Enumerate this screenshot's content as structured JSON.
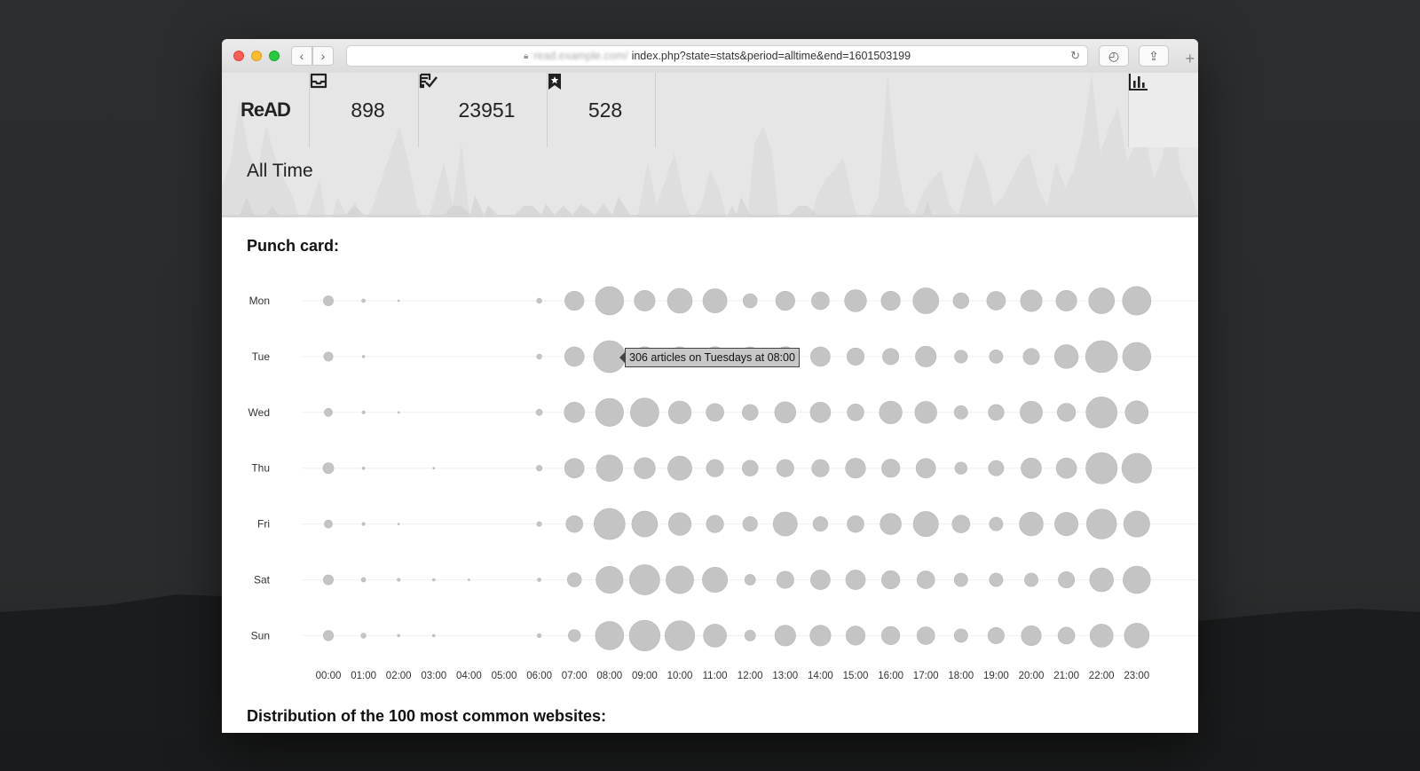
{
  "browser": {
    "url_blurred_host": "read.example.com/",
    "url_path": "index.php?state=stats&period=alltime&end=1601503199"
  },
  "nav": {
    "logo": "ReAD",
    "unread_count": "898",
    "read_count": "23951",
    "bookmarked_count": "528",
    "icons": [
      "inbox-icon",
      "read-check-icon",
      "bookmark-star-icon",
      "bar-chart-icon"
    ]
  },
  "period_title": "All Time",
  "punch_card": {
    "title": "Punch card:",
    "tooltip": "306 articles on Tuesdays at 08:00"
  },
  "next_section_title": "Distribution of the 100 most common websites:",
  "chart_data": {
    "type": "scatter",
    "title": "Punch card:",
    "days": [
      "Mon",
      "Tue",
      "Wed",
      "Thu",
      "Fri",
      "Sat",
      "Sun"
    ],
    "hours": [
      "00:00",
      "01:00",
      "02:00",
      "03:00",
      "04:00",
      "05:00",
      "06:00",
      "07:00",
      "08:00",
      "09:00",
      "10:00",
      "11:00",
      "12:00",
      "13:00",
      "14:00",
      "15:00",
      "16:00",
      "17:00",
      "18:00",
      "19:00",
      "20:00",
      "21:00",
      "22:00",
      "23:00"
    ],
    "values": [
      [
        30,
        4,
        1,
        0,
        0,
        0,
        8,
        110,
        240,
        130,
        185,
        175,
        60,
        110,
        95,
        145,
        110,
        200,
        75,
        105,
        140,
        130,
        200,
        245
      ],
      [
        25,
        2,
        0,
        0,
        0,
        0,
        8,
        115,
        306,
        120,
        115,
        120,
        115,
        120,
        115,
        90,
        80,
        130,
        50,
        55,
        80,
        170,
        305,
        240
      ],
      [
        20,
        3,
        1,
        0,
        0,
        0,
        12,
        125,
        235,
        245,
        155,
        95,
        75,
        135,
        125,
        85,
        155,
        145,
        55,
        75,
        150,
        100,
        290,
        160
      ],
      [
        35,
        2,
        0,
        1,
        0,
        0,
        10,
        115,
        210,
        135,
        175,
        90,
        75,
        90,
        90,
        120,
        100,
        115,
        45,
        70,
        125,
        125,
        295,
        265
      ],
      [
        20,
        3,
        1,
        0,
        0,
        0,
        7,
        85,
        290,
        200,
        155,
        90,
        65,
        175,
        65,
        85,
        135,
        190,
        95,
        55,
        170,
        165,
        270,
        205
      ],
      [
        30,
        6,
        3,
        2,
        1,
        0,
        4,
        60,
        220,
        275,
        230,
        190,
        35,
        90,
        115,
        115,
        100,
        95,
        55,
        55,
        55,
        80,
        170,
        225
      ],
      [
        32,
        8,
        2,
        2,
        0,
        0,
        5,
        45,
        240,
        285,
        265,
        160,
        35,
        130,
        130,
        110,
        100,
        95,
        55,
        80,
        120,
        85,
        160,
        185
      ]
    ],
    "ymax_value": 306,
    "grid": true,
    "legend": "none"
  }
}
